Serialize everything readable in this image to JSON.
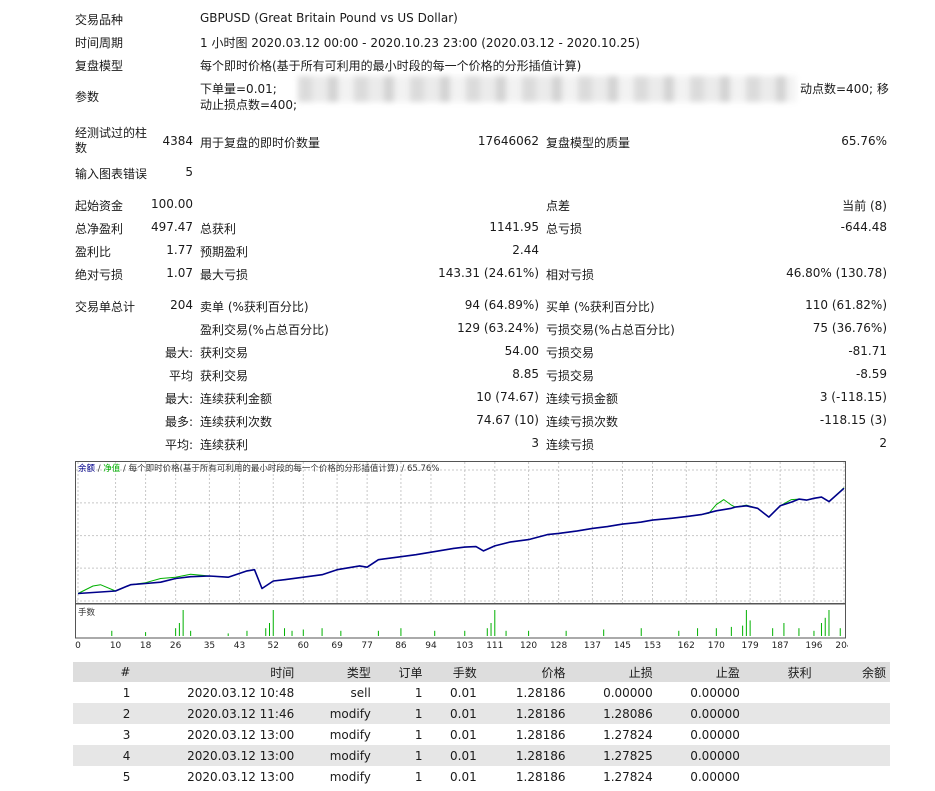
{
  "info": {
    "symbol_label": "交易品种",
    "symbol_value": "GBPUSD (Great Britain Pound vs US Dollar)",
    "period_label": "时间周期",
    "period_value": "1 小时图 2020.03.12 00:00 - 2020.10.23 23:00 (2020.03.12 - 2020.10.25)",
    "model_label": "复盘模型",
    "model_value": "每个即时价格(基于所有可利用的最小时段的每一个价格的分形插值计算)",
    "params_label": "参数",
    "params_line1_start": "下单量=0.01;",
    "params_line1_end": "动点数=400; 移",
    "params_line2": "动止损点数=400;"
  },
  "stats": {
    "bars_label": "经测试过的柱数",
    "bars_value": "4384",
    "ticks_label": "用于复盘的即时价数量",
    "ticks_value": "17646062",
    "quality_label": "复盘模型的质量",
    "quality_value": "65.76%",
    "errors_label": "输入图表错误",
    "errors_value": "5",
    "deposit_label": "起始资金",
    "deposit_value": "100.00",
    "spread_label": "点差",
    "spread_value": "当前 (8)",
    "netprofit_label": "总净盈利",
    "netprofit_value": "497.47",
    "grossprofit_label": "总获利",
    "grossprofit_value": "1141.95",
    "grossloss_label": "总亏损",
    "grossloss_value": "-644.48",
    "pf_label": "盈利比",
    "pf_value": "1.77",
    "payoff_label": "预期盈利",
    "payoff_value": "2.44",
    "absdd_label": "绝对亏损",
    "absdd_value": "1.07",
    "maxdd_label": "最大亏损",
    "maxdd_value": "143.31 (24.61%)",
    "reldd_label": "相对亏损",
    "reldd_value": "46.80% (130.78)",
    "total_label": "交易单总计",
    "total_value": "204",
    "short_label": "卖单 (%获利百分比)",
    "short_value": "94 (64.89%)",
    "long_label": "买单 (%获利百分比)",
    "long_value": "110 (61.82%)",
    "profit_trades_label": "盈利交易(%占总百分比)",
    "profit_trades_value": "129 (63.24%)",
    "loss_trades_label": "亏损交易(%占总百分比)",
    "loss_trades_value": "75 (36.76%)",
    "max_label": "最大:",
    "largest_profit_label": "获利交易",
    "largest_profit_value": "54.00",
    "largest_loss_label": "亏损交易",
    "largest_loss_value": "-81.71",
    "avg_label": "平均",
    "avg_profit_label": "获利交易",
    "avg_profit_value": "8.85",
    "avg_loss_label": "亏损交易",
    "avg_loss_value": "-8.59",
    "max2_label": "最大:",
    "max_cons_wins_label": "连续获利金额",
    "max_cons_wins_value": "10 (74.67)",
    "max_cons_losses_label": "连续亏损金额",
    "max_cons_losses_value": "3 (-118.15)",
    "most_label": "最多:",
    "max_cons_profit_label": "连续获利次数",
    "max_cons_profit_value": "74.67 (10)",
    "max_cons_loss_label": "连续亏损次数",
    "max_cons_loss_value": "-118.15 (3)",
    "avg2_label": "平均:",
    "avg_cons_wins_label": "连续获利",
    "avg_cons_wins_value": "3",
    "avg_cons_losses_label": "连续亏损",
    "avg_cons_losses_value": "2"
  },
  "chart": {
    "legend_balance": "余额",
    "legend_sep1": " / ",
    "legend_equity": "净值",
    "legend_rest": " / 每个即时价格(基于所有可利用的最小时段的每一个价格的分形插值计算) / 65.76%",
    "volume_label": "手数",
    "colors": {
      "balance": "#00008b",
      "equity": "#00b000",
      "volume": "#00b000",
      "grid": "#c8c8c8"
    }
  },
  "chart_data": {
    "type": "line",
    "y_ticks": [
      "598",
      "467",
      "336",
      "206",
      "75"
    ],
    "ylim": [
      75,
      598
    ],
    "x_ticks": [
      "0",
      "10",
      "18",
      "26",
      "35",
      "43",
      "52",
      "60",
      "69",
      "77",
      "86",
      "94",
      "103",
      "111",
      "120",
      "128",
      "137",
      "145",
      "153",
      "162",
      "170",
      "179",
      "187",
      "196",
      "204"
    ],
    "xlim": [
      0,
      204
    ],
    "series": [
      {
        "name": "余额",
        "x": [
          0,
          10,
          14,
          18,
          22,
          26,
          30,
          35,
          40,
          45,
          47,
          49,
          52,
          55,
          60,
          65,
          69,
          75,
          77,
          80,
          85,
          90,
          94,
          100,
          103,
          106,
          108,
          111,
          115,
          120,
          125,
          128,
          133,
          137,
          141,
          145,
          150,
          153,
          158,
          162,
          166,
          170,
          174,
          175,
          178,
          181,
          184,
          187,
          190,
          192,
          194,
          196,
          198,
          200,
          204
        ],
        "y": [
          105,
          115,
          140,
          145,
          150,
          165,
          172,
          175,
          170,
          195,
          200,
          125,
          155,
          160,
          170,
          180,
          200,
          215,
          210,
          240,
          250,
          260,
          270,
          285,
          290,
          292,
          275,
          295,
          310,
          320,
          340,
          345,
          355,
          365,
          372,
          382,
          390,
          398,
          405,
          412,
          420,
          435,
          445,
          450,
          455,
          445,
          410,
          455,
          470,
          482,
          478,
          485,
          490,
          472,
          525
        ]
      },
      {
        "name": "净值",
        "x": [
          0,
          4,
          6,
          10,
          14,
          18,
          22,
          26,
          30,
          35,
          40,
          45,
          47,
          49,
          52,
          55,
          60,
          65,
          69,
          75,
          77,
          80,
          85,
          90,
          94,
          100,
          103,
          106,
          108,
          111,
          115,
          120,
          125,
          128,
          133,
          137,
          141,
          145,
          150,
          153,
          158,
          162,
          166,
          168,
          170,
          172,
          174,
          175,
          178,
          181,
          184,
          187,
          190,
          192,
          194,
          196,
          198,
          200,
          204
        ],
        "y": [
          105,
          135,
          140,
          115,
          140,
          148,
          165,
          170,
          182,
          175,
          170,
          195,
          200,
          125,
          155,
          160,
          170,
          180,
          200,
          215,
          210,
          240,
          250,
          260,
          270,
          285,
          290,
          292,
          275,
          295,
          310,
          320,
          340,
          345,
          355,
          365,
          372,
          382,
          390,
          398,
          405,
          412,
          420,
          425,
          460,
          480,
          458,
          450,
          458,
          445,
          410,
          455,
          480,
          482,
          478,
          485,
          490,
          472,
          527
        ]
      }
    ],
    "volume": [
      {
        "x": 9,
        "v": 0.2
      },
      {
        "x": 18,
        "v": 0.15
      },
      {
        "x": 26,
        "v": 0.3
      },
      {
        "x": 27,
        "v": 0.5
      },
      {
        "x": 28,
        "v": 1.0
      },
      {
        "x": 30,
        "v": 0.2
      },
      {
        "x": 40,
        "v": 0.1
      },
      {
        "x": 45,
        "v": 0.2
      },
      {
        "x": 50,
        "v": 0.3
      },
      {
        "x": 51,
        "v": 0.5
      },
      {
        "x": 52,
        "v": 1.0
      },
      {
        "x": 55,
        "v": 0.3
      },
      {
        "x": 57,
        "v": 0.2
      },
      {
        "x": 60,
        "v": 0.25
      },
      {
        "x": 65,
        "v": 0.3
      },
      {
        "x": 70,
        "v": 0.2
      },
      {
        "x": 80,
        "v": 0.2
      },
      {
        "x": 86,
        "v": 0.3
      },
      {
        "x": 95,
        "v": 0.2
      },
      {
        "x": 103,
        "v": 0.2
      },
      {
        "x": 109,
        "v": 0.3
      },
      {
        "x": 110,
        "v": 0.5
      },
      {
        "x": 111,
        "v": 1.0
      },
      {
        "x": 114,
        "v": 0.2
      },
      {
        "x": 120,
        "v": 0.2
      },
      {
        "x": 130,
        "v": 0.2
      },
      {
        "x": 140,
        "v": 0.25
      },
      {
        "x": 150,
        "v": 0.3
      },
      {
        "x": 160,
        "v": 0.2
      },
      {
        "x": 165,
        "v": 0.3
      },
      {
        "x": 170,
        "v": 0.3
      },
      {
        "x": 174,
        "v": 0.35
      },
      {
        "x": 177,
        "v": 0.4
      },
      {
        "x": 178,
        "v": 1.0
      },
      {
        "x": 179,
        "v": 0.6
      },
      {
        "x": 185,
        "v": 0.3
      },
      {
        "x": 188,
        "v": 0.5
      },
      {
        "x": 192,
        "v": 0.3
      },
      {
        "x": 196,
        "v": 0.2
      },
      {
        "x": 198,
        "v": 0.5
      },
      {
        "x": 199,
        "v": 0.7
      },
      {
        "x": 200,
        "v": 1.0
      },
      {
        "x": 203,
        "v": 0.3
      }
    ]
  },
  "trades": {
    "headers": [
      "#",
      "时间",
      "类型",
      "订单",
      "手数",
      "价格",
      "止损",
      "止盈",
      "获利",
      "余额"
    ],
    "rows": [
      [
        "1",
        "2020.03.12 10:48",
        "sell",
        "1",
        "0.01",
        "1.28186",
        "0.00000",
        "0.00000",
        "",
        ""
      ],
      [
        "2",
        "2020.03.12 11:46",
        "modify",
        "1",
        "0.01",
        "1.28186",
        "1.28086",
        "0.00000",
        "",
        ""
      ],
      [
        "3",
        "2020.03.12 13:00",
        "modify",
        "1",
        "0.01",
        "1.28186",
        "1.27824",
        "0.00000",
        "",
        ""
      ],
      [
        "4",
        "2020.03.12 13:00",
        "modify",
        "1",
        "0.01",
        "1.28186",
        "1.27825",
        "0.00000",
        "",
        ""
      ],
      [
        "5",
        "2020.03.12 13:00",
        "modify",
        "1",
        "0.01",
        "1.28186",
        "1.27824",
        "0.00000",
        "",
        ""
      ]
    ]
  }
}
